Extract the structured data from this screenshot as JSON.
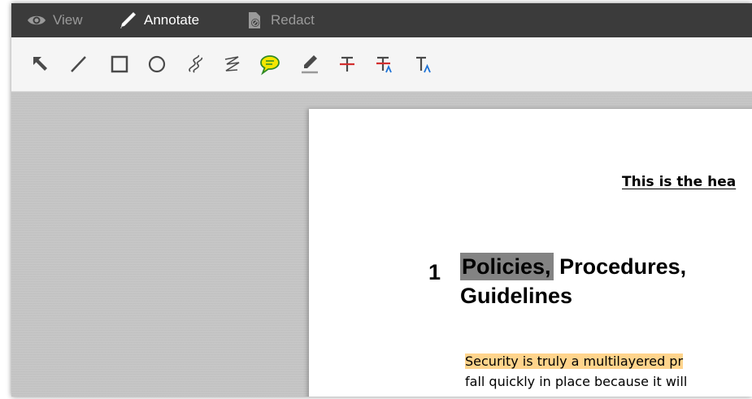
{
  "app": {
    "modes": [
      {
        "label": "View",
        "icon": "eye-icon",
        "active": false
      },
      {
        "label": "Annotate",
        "icon": "pen-icon",
        "active": true
      },
      {
        "label": "Redact",
        "icon": "redact-icon",
        "active": false
      }
    ],
    "tools": [
      "select-arrow-icon",
      "line-icon",
      "rectangle-icon",
      "ellipse-icon",
      "freehand-icon",
      "polyline-icon",
      "comment-icon",
      "highlighter-icon",
      "strikethrough-icon",
      "replace-text-icon",
      "insert-text-icon"
    ],
    "colors": {
      "mode_bar": "#3b3b3b",
      "toolbar": "#f5f5f5",
      "workspace": "#c6c6c6",
      "comment_yellow": "#f5e600",
      "strike_red": "#d32f2f",
      "caret_blue": "#1e73d6",
      "text_highlight": "#ffd48c",
      "redaction_gray": "#838383"
    }
  },
  "document": {
    "header_text": "This is the hea",
    "section_number": "1",
    "section_title_line1_redacted": "Policies,",
    "section_title_line1_rest": " Procedures,",
    "section_title_line2": "Guidelines",
    "body_line1": "Security is truly a multilayered pr",
    "body_line2": "fall quickly in place because it will"
  }
}
